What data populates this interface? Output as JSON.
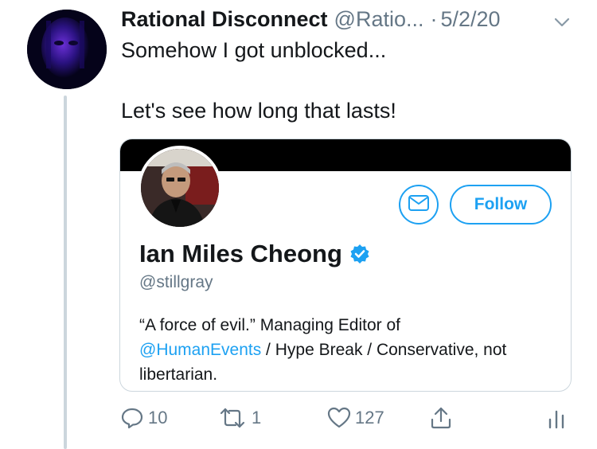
{
  "tweet": {
    "author_name": "Rational Disconnect",
    "author_handle": "@Ratio...",
    "separator": "·",
    "date": "5/2/20",
    "text_line1": "Somehow I got unblocked...",
    "text_line2": "Let's see how long that lasts!"
  },
  "card": {
    "follow_label": "Follow",
    "profile_name": "Ian Miles Cheong",
    "profile_handle": "@stillgray",
    "bio_line1": "“A force of evil.” Managing Editor of",
    "bio_mention": "@HumanEvents",
    "bio_rest": " / Hype Break / Conservative, not",
    "bio_line3": "libertarian."
  },
  "actions": {
    "reply_count": "10",
    "retweet_count": "1",
    "like_count": "127"
  },
  "icons": {
    "caret": "chevron-down-icon",
    "dm": "envelope-icon",
    "verified": "verified-badge-icon",
    "reply": "reply-icon",
    "retweet": "retweet-icon",
    "like": "heart-icon",
    "share": "share-icon",
    "analytics": "analytics-icon"
  },
  "colors": {
    "accent": "#1da1f2",
    "muted": "#657786",
    "text": "#14171a",
    "border": "#ccd6dd"
  }
}
